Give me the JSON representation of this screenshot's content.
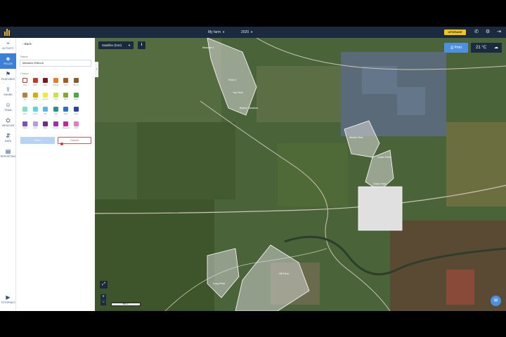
{
  "topbar": {
    "farm_name": "My farm",
    "year": "2020",
    "upgrade_label": "UPGRADE",
    "colors": {
      "bar": "#1c2a3f",
      "upgrade": "#f0c419"
    }
  },
  "rail": {
    "items": [
      {
        "label": "ACTIVITY",
        "icon": "activity-icon"
      },
      {
        "label": "FIELDS",
        "icon": "fields-icon",
        "active": true
      },
      {
        "label": "FEATURES",
        "icon": "features-icon"
      },
      {
        "label": "SHARE",
        "icon": "share-icon"
      },
      {
        "label": "TEAM",
        "icon": "team-icon"
      },
      {
        "label": "VEHICLES",
        "icon": "vehicles-icon"
      },
      {
        "label": "DATA",
        "icon": "data-icon"
      },
      {
        "label": "REPORTING",
        "icon": "reporting-icon"
      }
    ],
    "tutorials_label": "TUTORIALS"
  },
  "panel": {
    "back_label": "Back",
    "name_label": "Name",
    "name_value": "Meadow Without",
    "colour_label": "Colour",
    "swatches": [
      {
        "name": "Red",
        "color": "#ffffff",
        "selected": true
      },
      {
        "name": "Brick",
        "color": "#c0392b"
      },
      {
        "name": "Wine",
        "color": "#7b1622"
      },
      {
        "name": "Orange",
        "color": "#e67e22"
      },
      {
        "name": "Rust",
        "color": "#a35a28"
      },
      {
        "name": "Brown",
        "color": "#8b5a2b"
      },
      {
        "name": "Tan",
        "color": "#b5813e"
      },
      {
        "name": "Gold",
        "color": "#d4ac0d"
      },
      {
        "name": "Lemon",
        "color": "#f1e740"
      },
      {
        "name": "Lime",
        "color": "#c5e63c"
      },
      {
        "name": "Olive",
        "color": "#8da33a"
      },
      {
        "name": "Green",
        "color": "#4aa84a"
      },
      {
        "name": "Mint",
        "color": "#7fe0c0"
      },
      {
        "name": "Cyan",
        "color": "#5bd6e0"
      },
      {
        "name": "Sky",
        "color": "#5fb3ee"
      },
      {
        "name": "Teal",
        "color": "#2a8f8f"
      },
      {
        "name": "Blue",
        "color": "#2d6fcb"
      },
      {
        "name": "Navy",
        "color": "#2b3fa8"
      },
      {
        "name": "Violet",
        "color": "#7c4fc4"
      },
      {
        "name": "Lilac",
        "color": "#b49be6"
      },
      {
        "name": "Plum",
        "color": "#6d2f84"
      },
      {
        "name": "Purple",
        "color": "#9b2fae"
      },
      {
        "name": "Magenta",
        "color": "#c2279a"
      },
      {
        "name": "Pink",
        "color": "#e57bc8"
      }
    ],
    "save_label": "Save",
    "cancel_label": "Cancel"
  },
  "map": {
    "layer_label": "Satellite (Esri)",
    "print_label": "Print",
    "temperature": "21 °C",
    "scale_label": "500 m",
    "field_labels": [
      "Meadow 1",
      "Field 4",
      "Top Field",
      "Bottom Meadow",
      "Middle Field",
      "Lower Field",
      "Grass Field",
      "Long Field",
      "Hill Field"
    ]
  }
}
